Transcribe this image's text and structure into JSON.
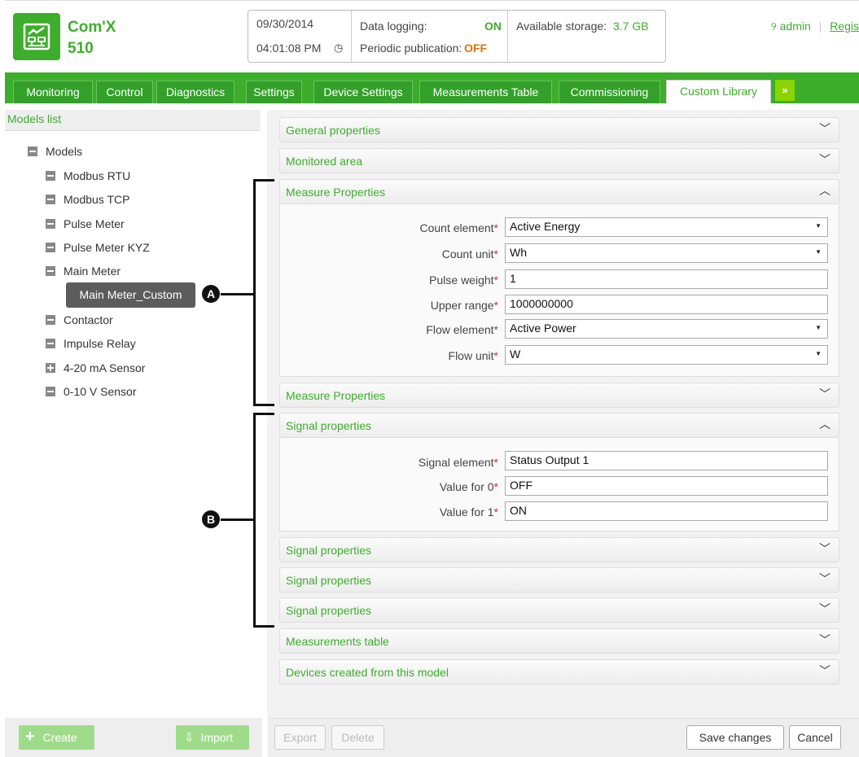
{
  "header": {
    "product_line1": "Com'X",
    "product_line2": "510",
    "date": "09/30/2014",
    "time": "04:01:08 PM",
    "data_logging_label": "Data logging:",
    "data_logging_value": "ON",
    "periodic_label": "Periodic publication:",
    "periodic_value": "OFF",
    "storage_label": "Available storage:",
    "storage_value": "3.7 GB",
    "user": "admin",
    "register": "Regis"
  },
  "tabs": [
    "Monitoring",
    "Control",
    "Diagnostics",
    "Settings",
    "Device Settings",
    "Measurements Table",
    "Commissioning",
    "Custom Library"
  ],
  "tab_more": "»",
  "models": {
    "title": "Models list",
    "root": "Models",
    "items": [
      "Modbus RTU",
      "Modbus TCP",
      "Pulse Meter",
      "Pulse Meter KYZ",
      "Main Meter",
      "Contactor",
      "Impulse Relay",
      "4-20 mA Sensor",
      "0-10 V Sensor"
    ],
    "selected": "Main Meter_Custom"
  },
  "annotations": {
    "a": "A",
    "b": "B"
  },
  "sections": {
    "general": "General properties",
    "monitored": "Monitored area",
    "measure1": "Measure Properties",
    "measure2": "Measure Properties",
    "signal1": "Signal properties",
    "signal2": "Signal properties",
    "signal3": "Signal properties",
    "signal4": "Signal properties",
    "measurements_table": "Measurements table",
    "devices_created": "Devices created from this model"
  },
  "measure_fields": {
    "count_element": {
      "label": "Count element",
      "value": "Active Energy"
    },
    "count_unit": {
      "label": "Count unit",
      "value": "Wh"
    },
    "pulse_weight": {
      "label": "Pulse weight",
      "value": "1"
    },
    "upper_range": {
      "label": "Upper range",
      "value": "1000000000"
    },
    "flow_element": {
      "label": "Flow element",
      "value": "Active Power"
    },
    "flow_unit": {
      "label": "Flow unit",
      "value": "W"
    }
  },
  "signal_fields": {
    "signal_element": {
      "label": "Signal element",
      "value": "Status Output 1"
    },
    "value0": {
      "label": "Value for 0",
      "value": "OFF"
    },
    "value1": {
      "label": "Value for 1",
      "value": "ON"
    }
  },
  "required_mark": "*",
  "buttons": {
    "create": "Create",
    "import": "Import",
    "export": "Export",
    "delete": "Delete",
    "save": "Save changes",
    "cancel": "Cancel"
  },
  "colors": {
    "brand_green": "#3dae2b",
    "tab_more": "#8bd400",
    "off_orange": "#e36c0a"
  }
}
